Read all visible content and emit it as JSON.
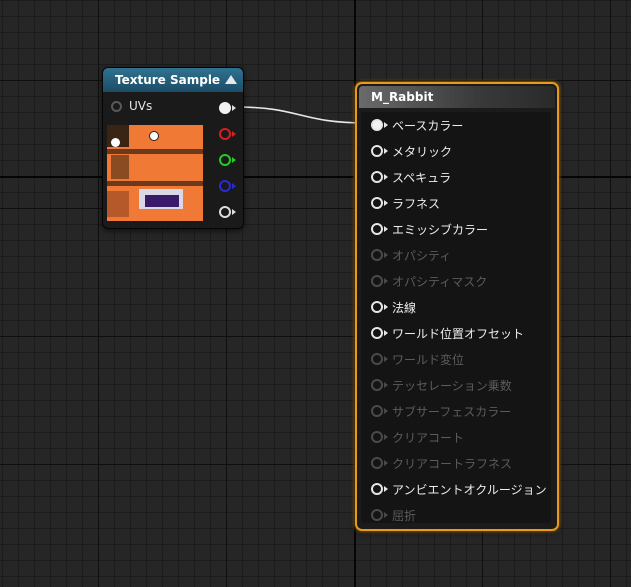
{
  "texture_node": {
    "title": "Texture Sample",
    "uv_label": "UVs",
    "output_pin_colors": [
      "#f2f2f2",
      "#d82020",
      "#22cc22",
      "#2a2ad8",
      "#dddddd"
    ]
  },
  "material_node": {
    "title": "M_Rabbit",
    "inputs": [
      {
        "label": "ベースカラー",
        "enabled": true,
        "connected": true
      },
      {
        "label": "メタリック",
        "enabled": true,
        "connected": false
      },
      {
        "label": "スペキュラ",
        "enabled": true,
        "connected": false
      },
      {
        "label": "ラフネス",
        "enabled": true,
        "connected": false
      },
      {
        "label": "エミッシブカラー",
        "enabled": true,
        "connected": false
      },
      {
        "label": "オパシティ",
        "enabled": false,
        "connected": false
      },
      {
        "label": "オパシティマスク",
        "enabled": false,
        "connected": false
      },
      {
        "label": "法線",
        "enabled": true,
        "connected": false
      },
      {
        "label": "ワールド位置オフセット",
        "enabled": true,
        "connected": false
      },
      {
        "label": "ワールド変位",
        "enabled": false,
        "connected": false
      },
      {
        "label": "テッセレーション乗数",
        "enabled": false,
        "connected": false
      },
      {
        "label": "サブサーフェスカラー",
        "enabled": false,
        "connected": false
      },
      {
        "label": "クリアコート",
        "enabled": false,
        "connected": false
      },
      {
        "label": "クリアコートラフネス",
        "enabled": false,
        "connected": false
      },
      {
        "label": "アンビエントオクルージョン",
        "enabled": true,
        "connected": false
      },
      {
        "label": "屈折",
        "enabled": false,
        "connected": false
      }
    ]
  },
  "colors": {
    "node_accent": "#e89a1a",
    "texture_header": "#2f7391",
    "wire": "#e8e8e8"
  }
}
